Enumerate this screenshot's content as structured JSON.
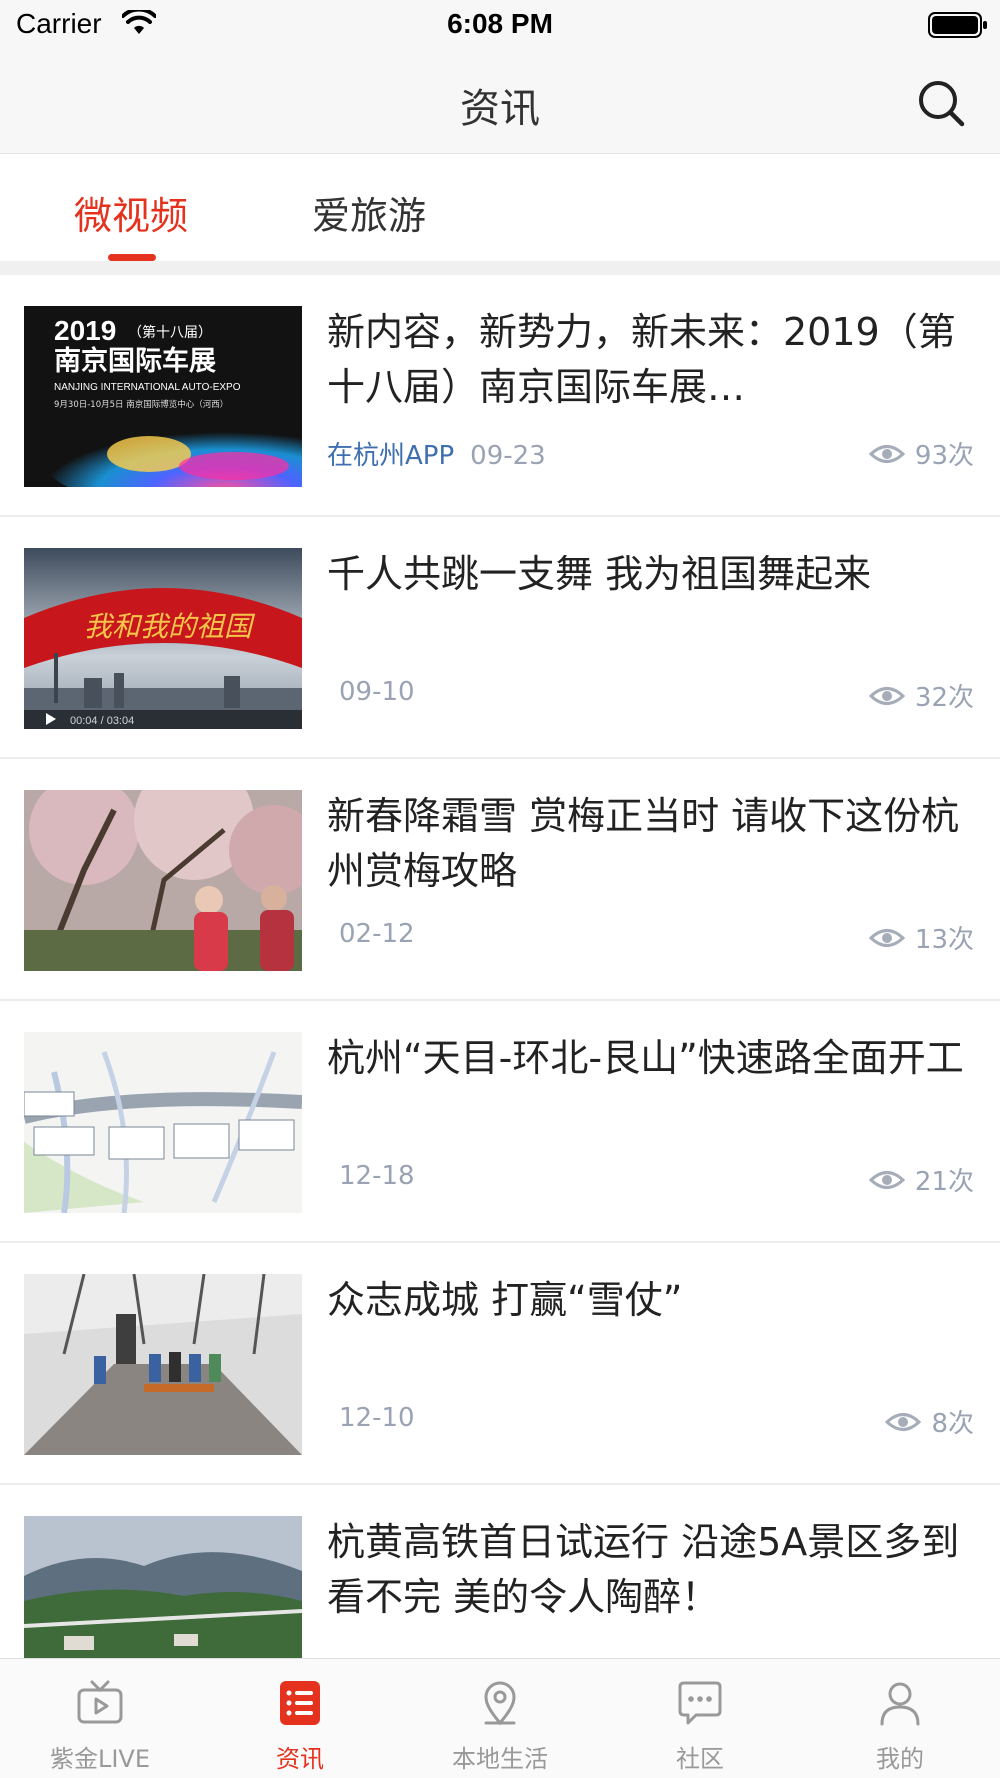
{
  "status_bar": {
    "carrier": "Carrier",
    "time": "6:08 PM"
  },
  "header": {
    "title": "资讯",
    "search_icon": "search-icon"
  },
  "tabs": [
    {
      "label": "微视频",
      "active": true
    },
    {
      "label": "爱旅游",
      "active": false
    }
  ],
  "news": [
    {
      "title": "新内容，新势力，新未来：2019（第十八届）南京国际车展…",
      "source": "在杭州APP",
      "date": "09-23",
      "views": "93次",
      "thumb_text": {
        "year": "2019",
        "edition": "（第十八届）",
        "name": "南京国际车展",
        "english": "NANJING INTERNATIONAL AUTO-EXPO",
        "dates": "9月30日-10月5日   南京国际博览中心（河西）"
      }
    },
    {
      "title": "千人共跳一支舞 我为祖国舞起来",
      "source": "",
      "date": "09-10",
      "views": "32次",
      "thumb_text": {
        "banner": "我和我的祖国",
        "timecode": "00:04 / 03:04"
      }
    },
    {
      "title": "新春降霜雪 赏梅正当时 请收下这份杭州赏梅攻略",
      "source": "",
      "date": "02-12",
      "views": "13次",
      "thumb_text": {}
    },
    {
      "title": "杭州“天目-环北-艮山”快速路全面开工",
      "source": "",
      "date": "12-18",
      "views": "21次",
      "thumb_text": {}
    },
    {
      "title": "众志成城 打赢“雪仗”",
      "source": "",
      "date": "12-10",
      "views": "8次",
      "thumb_text": {}
    },
    {
      "title": "杭黄高铁首日试运行 沿途5A景区多到看不完 美的令人陶醉！",
      "source": "",
      "date": "",
      "views": "",
      "thumb_text": {}
    }
  ],
  "tab_bar": [
    {
      "label": "紫金LIVE",
      "icon": "tv-icon",
      "active": false
    },
    {
      "label": "资讯",
      "icon": "news-list-icon",
      "active": true
    },
    {
      "label": "本地生活",
      "icon": "location-pin-icon",
      "active": false
    },
    {
      "label": "社区",
      "icon": "chat-bubble-icon",
      "active": false
    },
    {
      "label": "我的",
      "icon": "person-icon",
      "active": false
    }
  ],
  "colors": {
    "accent": "#e5321e",
    "source_link": "#3f6fb0",
    "meta_gray": "#9aa3b3"
  }
}
